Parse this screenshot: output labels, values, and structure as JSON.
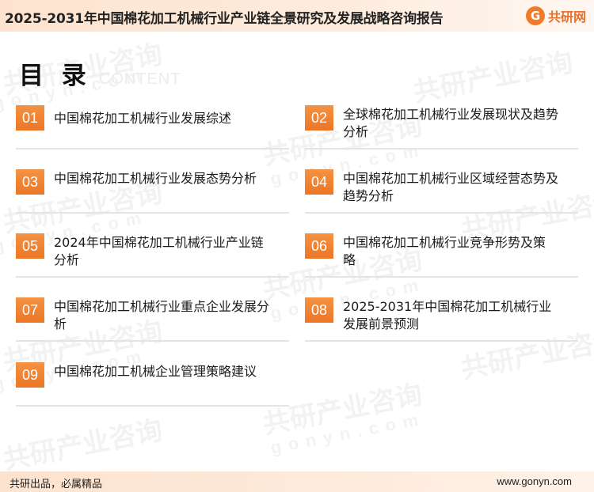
{
  "header": {
    "title": "2025-2031年中国棉花加工机械行业产业链全景研究及发展战略咨询报告",
    "logo_mark": "G",
    "logo_text": "共研网"
  },
  "toc": {
    "heading_zh": "目 录",
    "heading_en": "CONTENT"
  },
  "watermark": {
    "brand": "共研产业咨询",
    "site": "gonyn.com"
  },
  "items": [
    {
      "num": "01",
      "label": "中国棉花加工机械行业发展综述"
    },
    {
      "num": "02",
      "label": "全球棉花加工机械行业发展现状及趋势分析"
    },
    {
      "num": "03",
      "label": "中国棉花加工机械行业发展态势分析"
    },
    {
      "num": "04",
      "label": "中国棉花加工机械行业区域经营态势及趋势分析"
    },
    {
      "num": "05",
      "label": "2024年中国棉花加工机械行业产业链分析"
    },
    {
      "num": "06",
      "label": "中国棉花加工机械行业竞争形势及策略"
    },
    {
      "num": "07",
      "label": "中国棉花加工机械行业重点企业发展分析"
    },
    {
      "num": "08",
      "label": "2025-2031年中国棉花加工机械行业发展前景预测"
    },
    {
      "num": "09",
      "label": "中国棉花加工机械企业管理策略建议"
    }
  ],
  "footer": {
    "left": "共研出品，必属精品",
    "right": "www.gonyn.com"
  },
  "colors": {
    "accent": "#ec7626",
    "header_bg": "#fde3cf"
  }
}
